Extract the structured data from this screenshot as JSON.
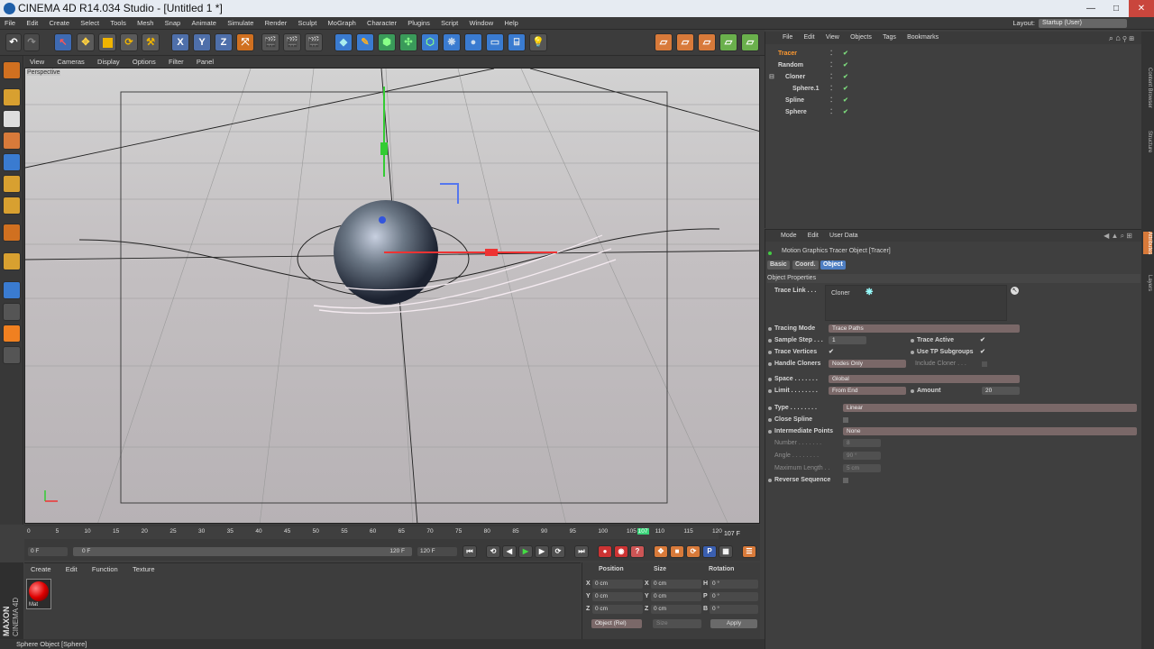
{
  "window": {
    "title": "CINEMA 4D R14.034 Studio - [Untitled 1 *]",
    "minimize": "—",
    "maximize": "□",
    "close": "✕"
  },
  "menubar": [
    "File",
    "Edit",
    "Create",
    "Select",
    "Tools",
    "Mesh",
    "Snap",
    "Animate",
    "Simulate",
    "Render",
    "Sculpt",
    "MoGraph",
    "Character",
    "Plugins",
    "Script",
    "Window",
    "Help"
  ],
  "layout": {
    "label": "Layout:",
    "value": "Startup (User)"
  },
  "toolbar": {
    "axis_x": "X",
    "axis_y": "Y",
    "axis_z": "Z"
  },
  "viewport": {
    "menu": [
      "View",
      "Cameras",
      "Display",
      "Options",
      "Filter",
      "Panel"
    ],
    "label": "Perspective"
  },
  "timeline": {
    "ticks": [
      "0",
      "5",
      "10",
      "15",
      "20",
      "25",
      "30",
      "35",
      "40",
      "45",
      "50",
      "55",
      "60",
      "65",
      "70",
      "75",
      "80",
      "85",
      "90",
      "95",
      "100",
      "105",
      "110",
      "115",
      "120"
    ],
    "current_frame": "107",
    "frame_readout": "107 F",
    "start_field": "0 F",
    "range_start": "0 F",
    "range_end": "120 F",
    "end_field": "120 F"
  },
  "material_manager": {
    "menu": [
      "Create",
      "Edit",
      "Function",
      "Texture"
    ],
    "material_name": "Mat"
  },
  "coord_manager": {
    "headers": [
      "Position",
      "Size",
      "Rotation"
    ],
    "rows": [
      {
        "axis": "X",
        "pos": "0 cm",
        "saxis": "X",
        "size": "0 cm",
        "raxis": "H",
        "rot": "0 °"
      },
      {
        "axis": "Y",
        "pos": "0 cm",
        "saxis": "Y",
        "size": "0 cm",
        "raxis": "P",
        "rot": "0 °"
      },
      {
        "axis": "Z",
        "pos": "0 cm",
        "saxis": "Z",
        "size": "0 cm",
        "raxis": "B",
        "rot": "0 °"
      }
    ],
    "mode_select": "Object (Rel)",
    "size_select": "Size",
    "apply": "Apply"
  },
  "maxon": {
    "brand": "MAXON",
    "product": "CINEMA 4D"
  },
  "status": "Sphere Object [Sphere]",
  "object_manager": {
    "menu": [
      "File",
      "Edit",
      "View",
      "Objects",
      "Tags",
      "Bookmarks"
    ],
    "objects": [
      {
        "name": "Tracer",
        "selected": true
      },
      {
        "name": "Random",
        "selected": false
      },
      {
        "name": "Cloner",
        "selected": false
      },
      {
        "name": "Sphere.1",
        "selected": false
      },
      {
        "name": "Spline",
        "selected": false
      },
      {
        "name": "Sphere",
        "selected": false
      }
    ]
  },
  "attribute_manager": {
    "menu": [
      "Mode",
      "Edit",
      "User Data"
    ],
    "object_title": "Motion Graphics Tracer Object [Tracer]",
    "tabs": [
      "Basic",
      "Coord.",
      "Object"
    ],
    "section": "Object Properties",
    "trace_link_label": "Trace Link . . .",
    "trace_link_value": "Cloner",
    "tracing_mode": {
      "label": "Tracing Mode",
      "value": "Trace Paths"
    },
    "sample_step": {
      "label": "Sample Step . . .",
      "value": "1"
    },
    "trace_active": {
      "label": "Trace Active",
      "value": "✔"
    },
    "trace_vertices": {
      "label": "Trace Vertices",
      "value": "✔"
    },
    "use_tp_subgroups": {
      "label": "Use TP Subgroups",
      "value": "✔"
    },
    "handle_cloners": {
      "label": "Handle Cloners",
      "value": "Nodes Only"
    },
    "include_cloner": {
      "label": "Include Cloner . . ."
    },
    "space": {
      "label": "Space . . . . . . .",
      "value": "Global"
    },
    "limit": {
      "label": "Limit . . . . . . . .",
      "value": "From End"
    },
    "amount": {
      "label": "Amount",
      "value": "20"
    },
    "type": {
      "label": "Type . . . . . . . .",
      "value": "Linear"
    },
    "close_spline": {
      "label": "Close Spline"
    },
    "intermediate_points": {
      "label": "Intermediate Points",
      "value": "None"
    },
    "number": {
      "label": "Number . . . . . . .",
      "value": "8"
    },
    "angle": {
      "label": "Angle . . . . . . . .",
      "value": "90 °"
    },
    "max_length": {
      "label": "Maximum Length . .",
      "value": "5 cm"
    },
    "reverse_sequence": {
      "label": "Reverse Sequence"
    }
  },
  "side_tabs": [
    "Content Browser",
    "Structure",
    "Attributes",
    "Layers"
  ]
}
